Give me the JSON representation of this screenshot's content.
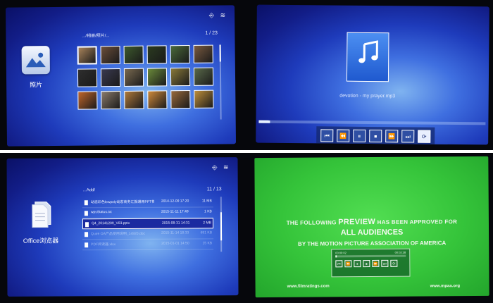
{
  "gallery": {
    "app_label": "照片",
    "path": ".../相册/照片/...",
    "counter": "1 / 23",
    "status_icons": [
      "usb-icon",
      "wifi-icon"
    ],
    "thumb_colors": [
      "#a8835a",
      "#6b4e3a",
      "#3d5a2d",
      "#2b3b20",
      "#4a6a3a",
      "#7a5a40",
      "#2e2e2e",
      "#3a3a50",
      "#7a6a50",
      "#6a8a3a",
      "#8a7a3a",
      "#5a6a4a",
      "#c0652a",
      "#8a7a6a",
      "#b07a3a",
      "#d08a3a",
      "#9a6a3a",
      "#c0903a"
    ]
  },
  "music": {
    "track": "devotion - my prayer.mp3",
    "progress": 0.05,
    "controls": [
      {
        "name": "prev-track-button",
        "glyph": "⏮"
      },
      {
        "name": "rewind-button",
        "glyph": "⏪"
      },
      {
        "name": "pause-button",
        "glyph": "⏸"
      },
      {
        "name": "stop-button",
        "glyph": "⏹"
      },
      {
        "name": "fast-forward-button",
        "glyph": "⏩"
      },
      {
        "name": "next-track-button",
        "glyph": "⏭"
      },
      {
        "name": "repeat-button",
        "glyph": "⟳"
      }
    ]
  },
  "office": {
    "app_label": "Office浏览器",
    "path": "...Add/",
    "counter": "11 / 13",
    "files": [
      {
        "name": "动态彩色lowpoly动态商务汇报通用PPT模板.pptx",
        "date": "2014-12-09 17:20",
        "size": "11 MB",
        "state": "normal"
      },
      {
        "name": "wpsStatus.txt",
        "date": "2015-11-11 17:49",
        "size": "1 KB",
        "state": "normal"
      },
      {
        "name": "Q4_20141209_V03.pptx",
        "date": "2015-08-31 14:31",
        "size": "2 MB",
        "state": "selected"
      },
      {
        "name": "Quire OA产品使用说明_14920.doc",
        "date": "2015-11-14 18:33",
        "size": "681 KB",
        "state": "dim"
      },
      {
        "name": "PDF阅读器.xlsx",
        "date": "2015-01-01 14:50",
        "size": "15 KB",
        "state": "dim"
      }
    ]
  },
  "trailer": {
    "line1_a": "THE FOLLOWING ",
    "line1_b": "PREVIEW",
    "line1_c": " HAS BEEN APPROVED FOR",
    "line2": "ALL AUDIENCES",
    "line3": "BY THE MOTION PICTURE ASSOCIATION OF AMERICA",
    "time_elapsed": "00:00:02",
    "time_total": "00:02:28",
    "progress": 0.02,
    "url_left": "www.filmratings.com",
    "url_right": "www.mpaa.org"
  }
}
